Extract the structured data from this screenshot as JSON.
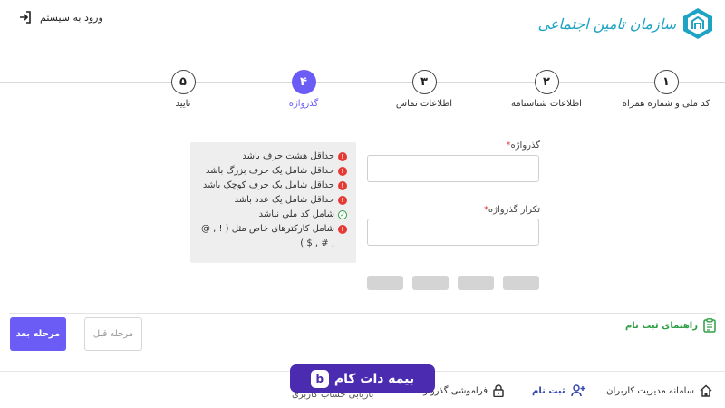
{
  "header": {
    "login_label": "ورود به سیستم",
    "logo_text": "سازمان تامین اجتماعی"
  },
  "stepper": {
    "steps": [
      {
        "number": "۱",
        "label": "کد ملی و شماره همراه"
      },
      {
        "number": "۲",
        "label": "اطلاعات شناسنامه"
      },
      {
        "number": "۳",
        "label": "اطلاعات تماس"
      },
      {
        "number": "۴",
        "label": "گذرواژه"
      },
      {
        "number": "۵",
        "label": "تایید"
      }
    ],
    "active_step": 4
  },
  "requirements": [
    {
      "text": "حداقل هشت حرف باشد",
      "status": "error"
    },
    {
      "text": "حداقل شامل یک حرف بزرگ باشد",
      "status": "error"
    },
    {
      "text": "حداقل شامل یک حرف کوچک باشد",
      "status": "error"
    },
    {
      "text": "حداقل شامل یک عدد باشد",
      "status": "error"
    },
    {
      "text": "شامل کد ملی نباشد",
      "status": "ok"
    },
    {
      "text": "شامل کارکترهای خاص مثل ( ! , @ , # , $ )",
      "status": "error"
    }
  ],
  "form": {
    "password_label": "گذرواژه",
    "password_value": "",
    "confirm_label": "تکرار گذرواژه",
    "confirm_value": "",
    "required_mark": "*"
  },
  "strength_meter": {
    "segments": 4,
    "filled": 0
  },
  "nav": {
    "next_label": "مرحله بعد",
    "prev_label": "مرحله قبل",
    "guide_label": "راهنمای ثبت نام"
  },
  "footer": {
    "items": [
      {
        "label": "سامانه مدیریت کاربران"
      },
      {
        "label": "ثبت نام"
      },
      {
        "label": "فراموشی گذرواژه"
      },
      {
        "label": "بازیابی حساب کاربری"
      }
    ]
  },
  "watermark": {
    "text": "بیمه دات کام"
  },
  "colors": {
    "accent": "#6b5cf5",
    "error": "#e53935",
    "success": "#2e9e44",
    "logo": "#1fa3c5",
    "badge": "#4b2bb0"
  }
}
